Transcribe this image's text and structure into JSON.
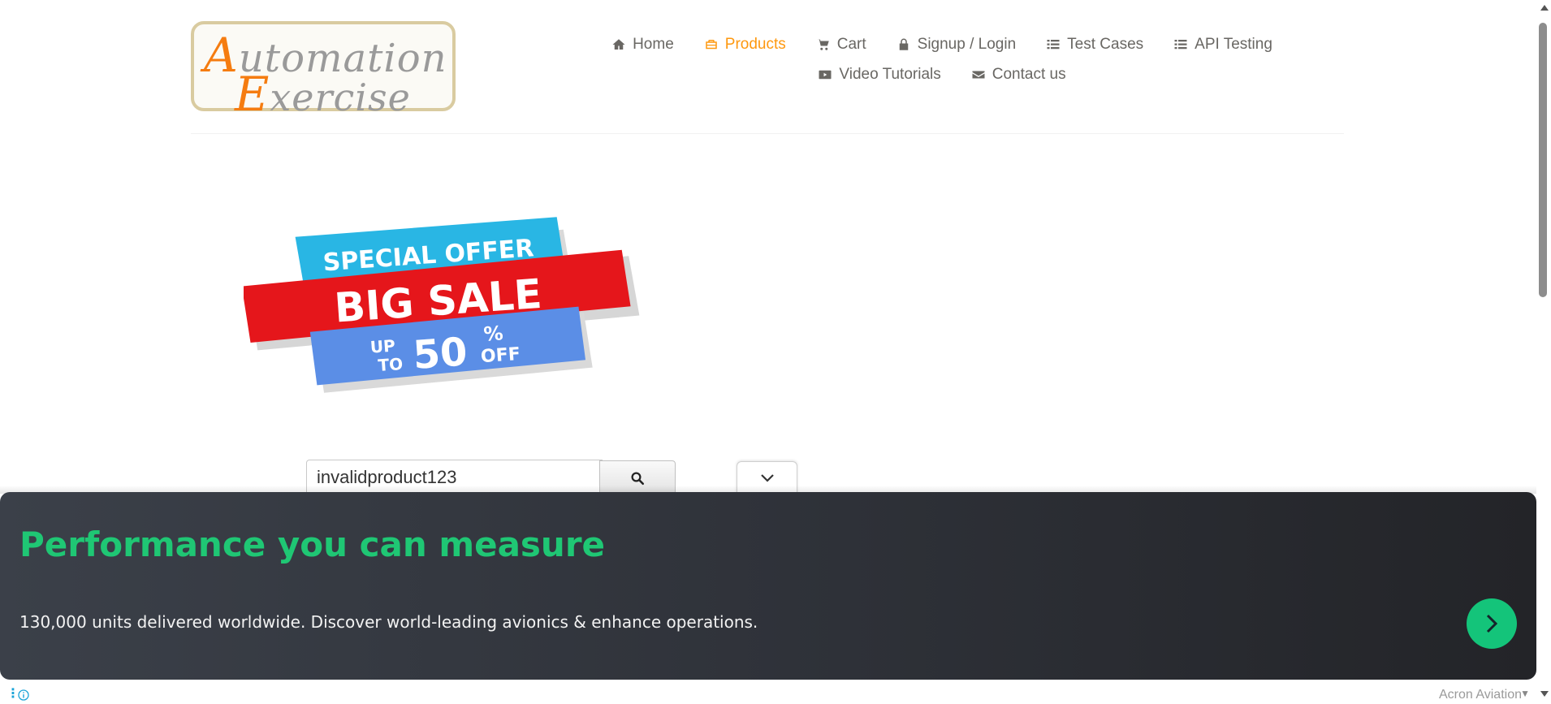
{
  "logo": {
    "line1_cap": "A",
    "line1_rest": "utomation",
    "line2_cap": "E",
    "line2_rest": "xercise"
  },
  "nav": {
    "items": [
      {
        "label": "Home",
        "icon": "home-icon",
        "active": false
      },
      {
        "label": "Products",
        "icon": "briefcase-icon",
        "active": true
      },
      {
        "label": "Cart",
        "icon": "cart-icon",
        "active": false
      },
      {
        "label": "Signup / Login",
        "icon": "lock-icon",
        "active": false
      },
      {
        "label": "Test Cases",
        "icon": "list-icon",
        "active": false
      },
      {
        "label": "API Testing",
        "icon": "list-icon",
        "active": false
      },
      {
        "label": "Video Tutorials",
        "icon": "youtube-icon",
        "active": false
      },
      {
        "label": "Contact us",
        "icon": "envelope-icon",
        "active": false
      }
    ]
  },
  "banner": {
    "top": "SPECIAL OFFER",
    "middle": "BIG SALE",
    "up": "UP",
    "to": "TO",
    "percent_value": "50",
    "percent_sign": "%",
    "off": "OFF"
  },
  "search": {
    "value": "invalidproduct123"
  },
  "ad": {
    "title": "Performance you can measure",
    "description": "130,000 units delivered worldwide. Discover world-leading avionics & enhance operations.",
    "sponsor": "Acron Aviation"
  },
  "colors": {
    "accent": "#fe980f",
    "nav_text": "#696763",
    "ad_title": "#1fc774",
    "ad_cta": "#14c47a",
    "ad_bg": "#2e3138"
  }
}
